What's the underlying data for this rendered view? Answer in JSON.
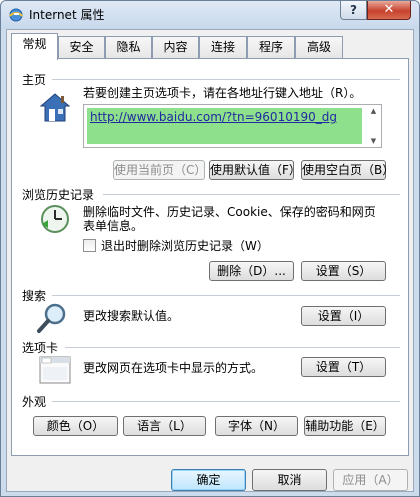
{
  "window": {
    "title": "Internet 属性"
  },
  "titlebar": {
    "help": "?",
    "close": "✕"
  },
  "tabs": [
    "常规",
    "安全",
    "隐私",
    "内容",
    "连接",
    "程序",
    "高级"
  ],
  "home": {
    "label": "主页",
    "description": "若要创建主页选项卡，请在各地址行键入地址（R）。",
    "url": "http://www.baidu.com/?tn=96010190_dg",
    "use_current": "使用当前页（C）",
    "use_default": "使用默认值（F）",
    "use_blank": "使用空白页（B）"
  },
  "history": {
    "label": "浏览历史记录",
    "description_line1": "删除临时文件、历史记录、Cookie、保存的密码和网页",
    "description_line2": "表单信息。",
    "checkbox_label": "退出时删除浏览历史记录（W）",
    "delete": "删除（D）...",
    "settings": "设置（S）"
  },
  "search": {
    "label": "搜索",
    "description": "更改搜索默认值。",
    "settings": "设置（I）"
  },
  "tabs_section": {
    "label": "选项卡",
    "description": "更改网页在选项卡中显示的方式。",
    "settings": "设置（T）"
  },
  "appearance": {
    "label": "外观",
    "colors": "颜色（O）",
    "languages": "语言（L）",
    "fonts": "字体（N）",
    "accessibility": "辅助功能（E）"
  },
  "footer": {
    "ok": "确定",
    "cancel": "取消",
    "apply": "应用（A）"
  },
  "icons": [
    "ie-globe-icon",
    "home-icon",
    "history-icon",
    "search-icon",
    "tabs-icon"
  ],
  "colors": {
    "selection": "#8fe08c",
    "link": "#1f2b9e",
    "close_button": "#c7422e"
  }
}
